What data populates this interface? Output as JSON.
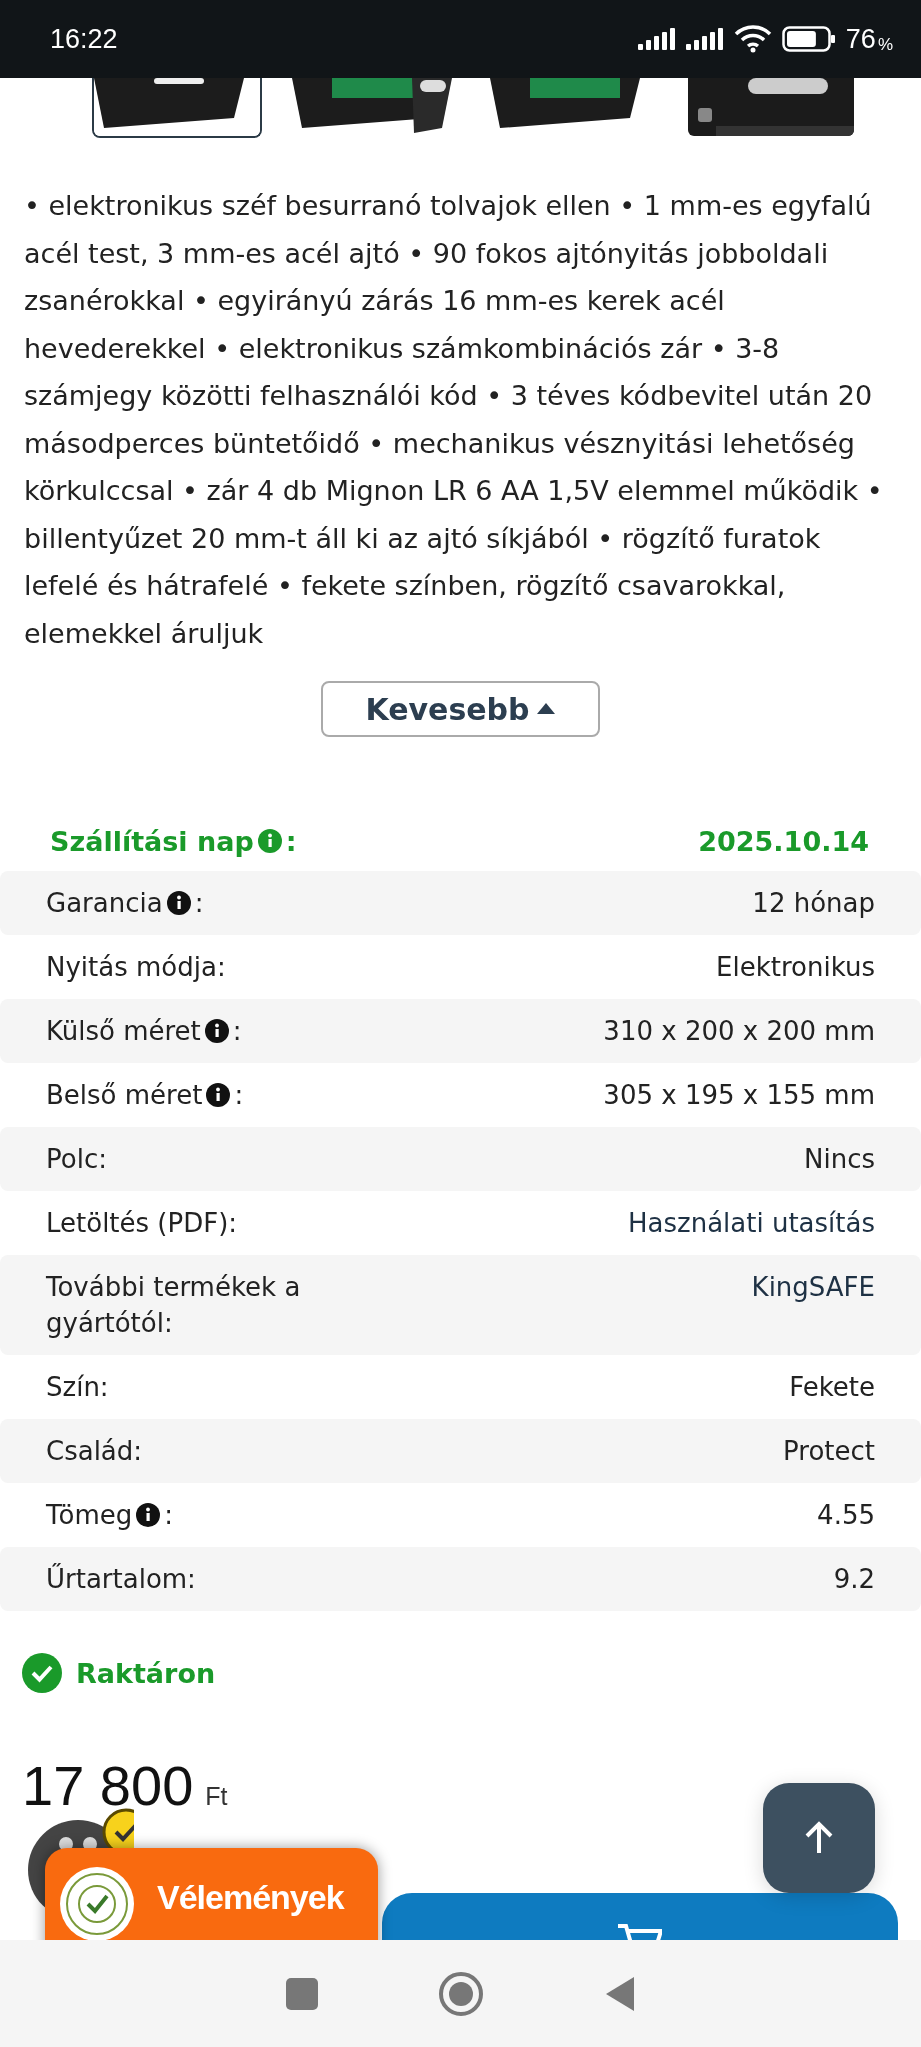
{
  "status_bar": {
    "time": "16:22",
    "battery": "76",
    "battery_unit": "%"
  },
  "thumbnails": [
    {
      "kind": "picture",
      "selected": true
    },
    {
      "kind": "picture",
      "selected": false
    },
    {
      "kind": "picture",
      "selected": false
    },
    {
      "kind": "picture",
      "selected": false
    }
  ],
  "description": "• elektronikus széf besurranó tolvajok ellen • 1 mm-es egyfalú acél test, 3 mm-es acél ajtó • 90 fokos ajtónyitás jobboldali zsanérokkal • egyirányú zárás 16 mm-es kerek acél hevederekkel • elektronikus számkombinációs zár • 3-8 számjegy közötti felhasználói kód • 3 téves kódbevitel után 20 másodperces büntetőidő • mechanikus vésznyitási lehetőség körkulccsal • zár 4 db Mignon LR 6 AA 1,5V elemmel működik • billentyűzet 20 mm-t áll ki az ajtó síkjából • rögzítő furatok lefelé és hátrafelé • fekete színben, rögzítő csavarokkal, elemekkel áruljuk",
  "less_button": "Kevesebb",
  "shipping": {
    "label": "Szállítási nap",
    "colon": ":",
    "value": "2025.10.14"
  },
  "specs": [
    {
      "label": "Garancia",
      "colon": ":",
      "value": "12 hónap",
      "info": true,
      "link": false
    },
    {
      "label": "Nyitás módja:",
      "value": "Elektronikus",
      "info": false,
      "link": false
    },
    {
      "label": "Külső méret",
      "colon": ":",
      "value": "310 x 200 x 200 mm",
      "info": true,
      "link": false
    },
    {
      "label": "Belső méret",
      "colon": ":",
      "value": "305 x 195 x 155 mm",
      "info": true,
      "link": false
    },
    {
      "label": "Polc:",
      "value": "Nincs",
      "info": false,
      "link": false
    },
    {
      "label": "Letöltés (PDF):",
      "value": "Használati utasítás",
      "info": false,
      "link": true
    },
    {
      "label": "További termékek a gyártótól:",
      "value": "KingSAFE",
      "info": false,
      "link": true
    },
    {
      "label": "Szín:",
      "value": "Fekete",
      "info": false,
      "link": false
    },
    {
      "label": "Család:",
      "value": "Protect",
      "info": false,
      "link": false
    },
    {
      "label": "Tömeg",
      "colon": ":",
      "value": "4.55",
      "info": true,
      "link": false
    },
    {
      "label": "Űrtartalom:",
      "value": "9.2",
      "info": false,
      "link": false
    }
  ],
  "stock": {
    "label": "Raktáron",
    "in_stock": true
  },
  "price": {
    "amount": "17 800",
    "currency": "Ft"
  },
  "reviews_badge": {
    "label": "Vélemények"
  }
}
